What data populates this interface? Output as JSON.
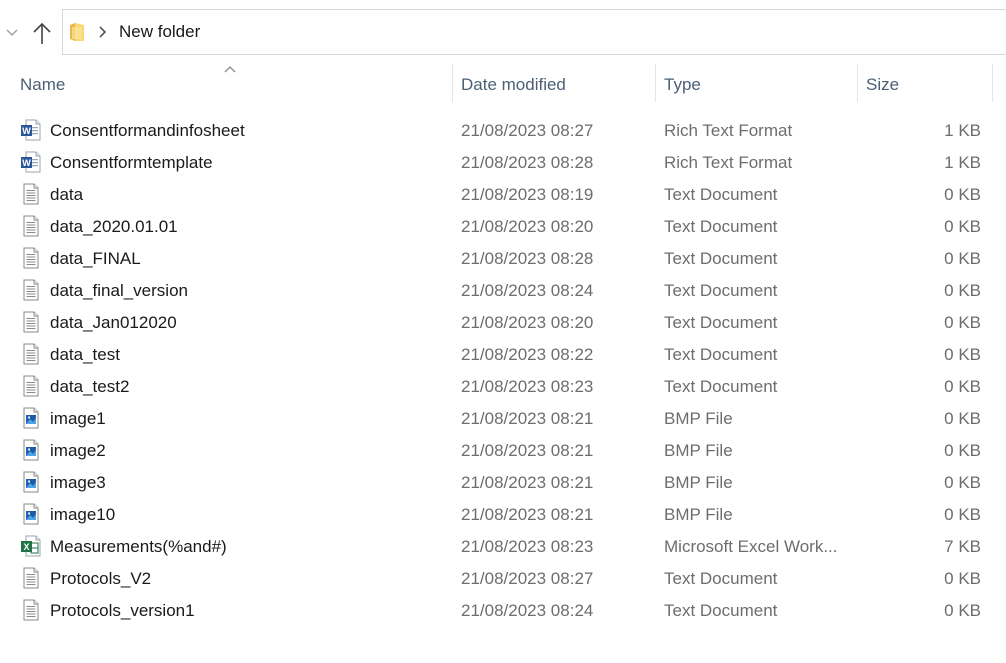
{
  "breadcrumb": {
    "label": "New folder"
  },
  "columns": {
    "name": "Name",
    "date": "Date modified",
    "type": "Type",
    "size": "Size"
  },
  "colors": {
    "header_text": "#4b5f75",
    "secondary_text": "#6d6d6d",
    "word_blue": "#2b579a",
    "excel_green": "#217346",
    "folder_yellow": "#f8d775"
  },
  "files": [
    {
      "name": "Consentformandinfosheet",
      "date": "21/08/2023 08:27",
      "type": "Rich Text Format",
      "size": "1 KB",
      "icon": "word-document-icon"
    },
    {
      "name": "Consentformtemplate",
      "date": "21/08/2023 08:28",
      "type": "Rich Text Format",
      "size": "1 KB",
      "icon": "word-document-icon"
    },
    {
      "name": "data",
      "date": "21/08/2023 08:19",
      "type": "Text Document",
      "size": "0 KB",
      "icon": "text-document-icon"
    },
    {
      "name": "data_2020.01.01",
      "date": "21/08/2023 08:20",
      "type": "Text Document",
      "size": "0 KB",
      "icon": "text-document-icon"
    },
    {
      "name": "data_FINAL",
      "date": "21/08/2023 08:28",
      "type": "Text Document",
      "size": "0 KB",
      "icon": "text-document-icon"
    },
    {
      "name": "data_final_version",
      "date": "21/08/2023 08:24",
      "type": "Text Document",
      "size": "0 KB",
      "icon": "text-document-icon"
    },
    {
      "name": "data_Jan012020",
      "date": "21/08/2023 08:20",
      "type": "Text Document",
      "size": "0 KB",
      "icon": "text-document-icon"
    },
    {
      "name": "data_test",
      "date": "21/08/2023 08:22",
      "type": "Text Document",
      "size": "0 KB",
      "icon": "text-document-icon"
    },
    {
      "name": "data_test2",
      "date": "21/08/2023 08:23",
      "type": "Text Document",
      "size": "0 KB",
      "icon": "text-document-icon"
    },
    {
      "name": "image1",
      "date": "21/08/2023 08:21",
      "type": "BMP File",
      "size": "0 KB",
      "icon": "bitmap-image-icon"
    },
    {
      "name": "image2",
      "date": "21/08/2023 08:21",
      "type": "BMP File",
      "size": "0 KB",
      "icon": "bitmap-image-icon"
    },
    {
      "name": "image3",
      "date": "21/08/2023 08:21",
      "type": "BMP File",
      "size": "0 KB",
      "icon": "bitmap-image-icon"
    },
    {
      "name": "image10",
      "date": "21/08/2023 08:21",
      "type": "BMP File",
      "size": "0 KB",
      "icon": "bitmap-image-icon"
    },
    {
      "name": "Measurements(%and#)",
      "date": "21/08/2023 08:23",
      "type": "Microsoft Excel Work...",
      "size": "7 KB",
      "icon": "excel-workbook-icon"
    },
    {
      "name": "Protocols_V2",
      "date": "21/08/2023 08:27",
      "type": "Text Document",
      "size": "0 KB",
      "icon": "text-document-icon"
    },
    {
      "name": "Protocols_version1",
      "date": "21/08/2023 08:24",
      "type": "Text Document",
      "size": "0 KB",
      "icon": "text-document-icon"
    }
  ]
}
